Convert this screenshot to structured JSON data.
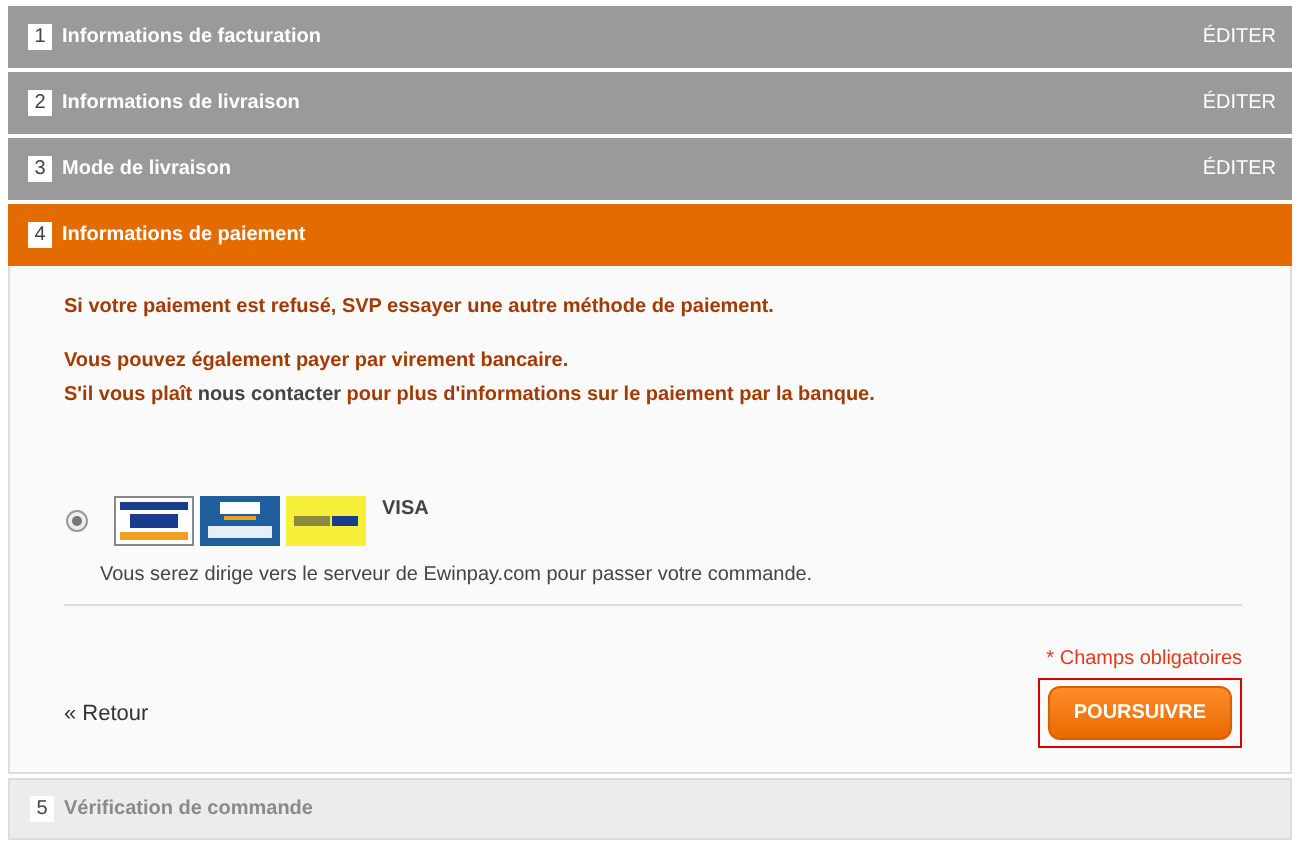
{
  "steps": [
    {
      "number": "1",
      "title": "Informations de facturation",
      "kind": "done",
      "action": "ÉDITER"
    },
    {
      "number": "2",
      "title": "Informations de livraison",
      "kind": "done",
      "action": "ÉDITER"
    },
    {
      "number": "3",
      "title": "Mode de livraison",
      "kind": "done",
      "action": "ÉDITER"
    },
    {
      "number": "4",
      "title": "Informations de paiement",
      "kind": "active"
    },
    {
      "number": "5",
      "title": "Vérification de commande",
      "kind": "pending"
    }
  ],
  "payment": {
    "notice": "Si votre paiement est refusé, SVP essayer une autre méthode de paiement.",
    "transfer_line": "Vous pouvez également payer par virement bancaire.",
    "contact_before": "S'il vous plaît ",
    "contact_link": "nous contacter",
    "contact_after": " pour plus d'informations sur le paiement par la banque.",
    "methods": [
      {
        "label": "VISA",
        "selected": true,
        "note": "Vous serez dirige vers le serveur de Ewinpay.com pour passer votre commande."
      }
    ],
    "required_note": "* Champs obligatoires",
    "back_link": "« Retour",
    "continue_button": "POURSUIVRE"
  }
}
